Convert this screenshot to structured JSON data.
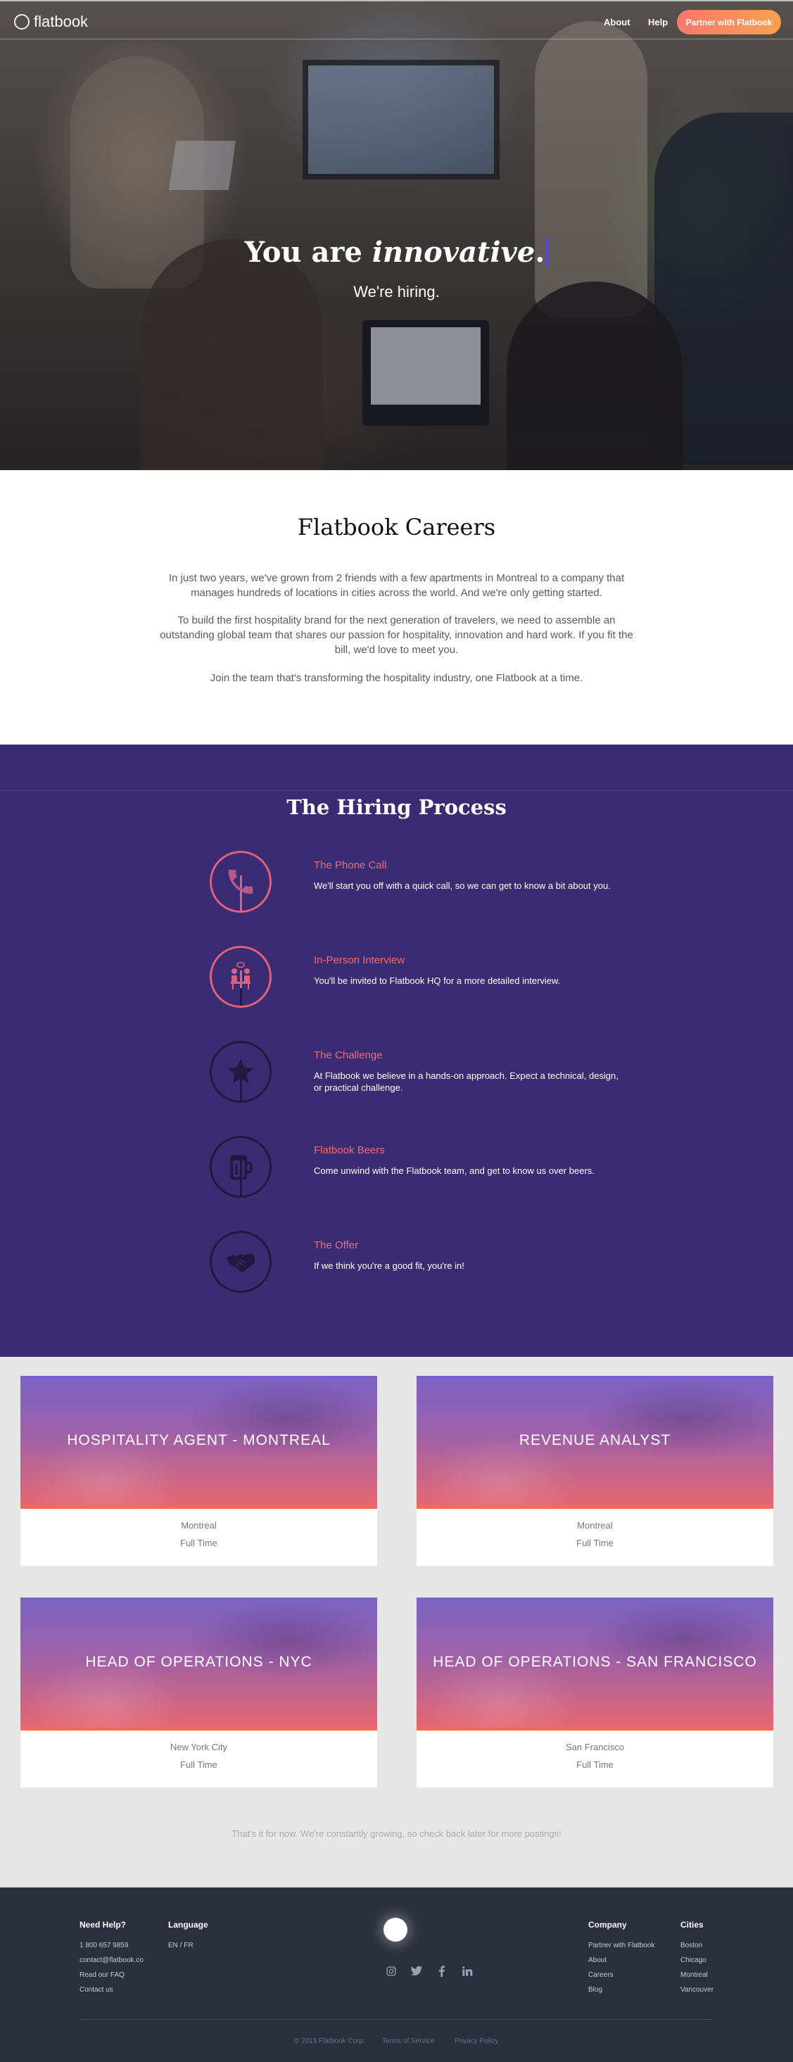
{
  "nav": {
    "logo": "flatbook",
    "about": "About",
    "help": "Help",
    "cta": "Partner with Flatbook"
  },
  "hero": {
    "title_prefix": "You are ",
    "title_word": "innovative",
    "title_suffix": ".",
    "subtitle": "We're hiring."
  },
  "careers": {
    "title": "Flatbook Careers",
    "paragraphs": [
      "In just two years, we've grown from 2 friends with a few apartments in Montreal to a company that manages hundreds of locations in cities across the world. And we're only getting started.",
      "To build the first hospitality brand for the next generation of travelers, we need to assemble an outstanding global team that shares our passion for hospitality, innovation and hard work. If you fit the bill, we'd love to meet you.",
      "Join the team that's transforming the hospitality industry, one Flatbook at a time."
    ]
  },
  "hiring": {
    "title": "The Hiring Process",
    "steps": [
      {
        "title": "The Phone Call",
        "desc": "We'll start you off with a quick call, so we can get to know a bit about you.",
        "icon": "phone-icon"
      },
      {
        "title": "In-Person Interview",
        "desc": "You'll be invited to Flatbook HQ for a more detailed interview.",
        "icon": "interview-icon"
      },
      {
        "title": "The Challenge",
        "desc": "At Flatbook we believe in a hands-on approach. Expect a technical, design, or practical challenge.",
        "icon": "star-icon"
      },
      {
        "title": "Flatbook Beers",
        "desc": "Come unwind with the Flatbook team, and get to know us over beers.",
        "icon": "beer-mug-icon"
      },
      {
        "title": "The Offer",
        "desc": "If we think you're a good fit, you're in!",
        "icon": "handshake-icon"
      }
    ],
    "colors": {
      "active": "#e0607a",
      "inactive": "#22193f",
      "background": "#3a2c73"
    }
  },
  "jobs": {
    "postings": [
      {
        "title": "HOSPITALITY AGENT - MONTREAL",
        "city": "Montreal",
        "type": "Full Time"
      },
      {
        "title": "REVENUE ANALYST",
        "city": "Montreal",
        "type": "Full Time"
      },
      {
        "title": "HEAD OF OPERATIONS - NYC",
        "city": "New York City",
        "type": "Full Time"
      },
      {
        "title": "HEAD OF OPERATIONS - SAN FRANCISCO",
        "city": "San Francisco",
        "type": "Full Time"
      }
    ],
    "note": "That's it for now. We're constantly growing, so check back later for more postings!"
  },
  "footer": {
    "need_help": {
      "title": "Need Help?",
      "items": [
        "1 800 657 9859",
        "contact@flatbook.co",
        "Read our FAQ",
        "Contact us"
      ]
    },
    "language": {
      "title": "Language",
      "value": "EN / FR"
    },
    "company": {
      "title": "Company",
      "items": [
        "Partner with Flatbook",
        "About",
        "Careers",
        "Blog"
      ]
    },
    "cities": {
      "title": "Cities",
      "items": [
        "Boston",
        "Chicago",
        "Montreal",
        "Vancouver"
      ]
    },
    "social": [
      "instagram-icon",
      "twitter-icon",
      "facebook-icon",
      "linkedin-icon"
    ],
    "copyright": "© 2015 Flatbook Corp.",
    "terms": "Terms of Service",
    "privacy": "Privacy Policy"
  }
}
